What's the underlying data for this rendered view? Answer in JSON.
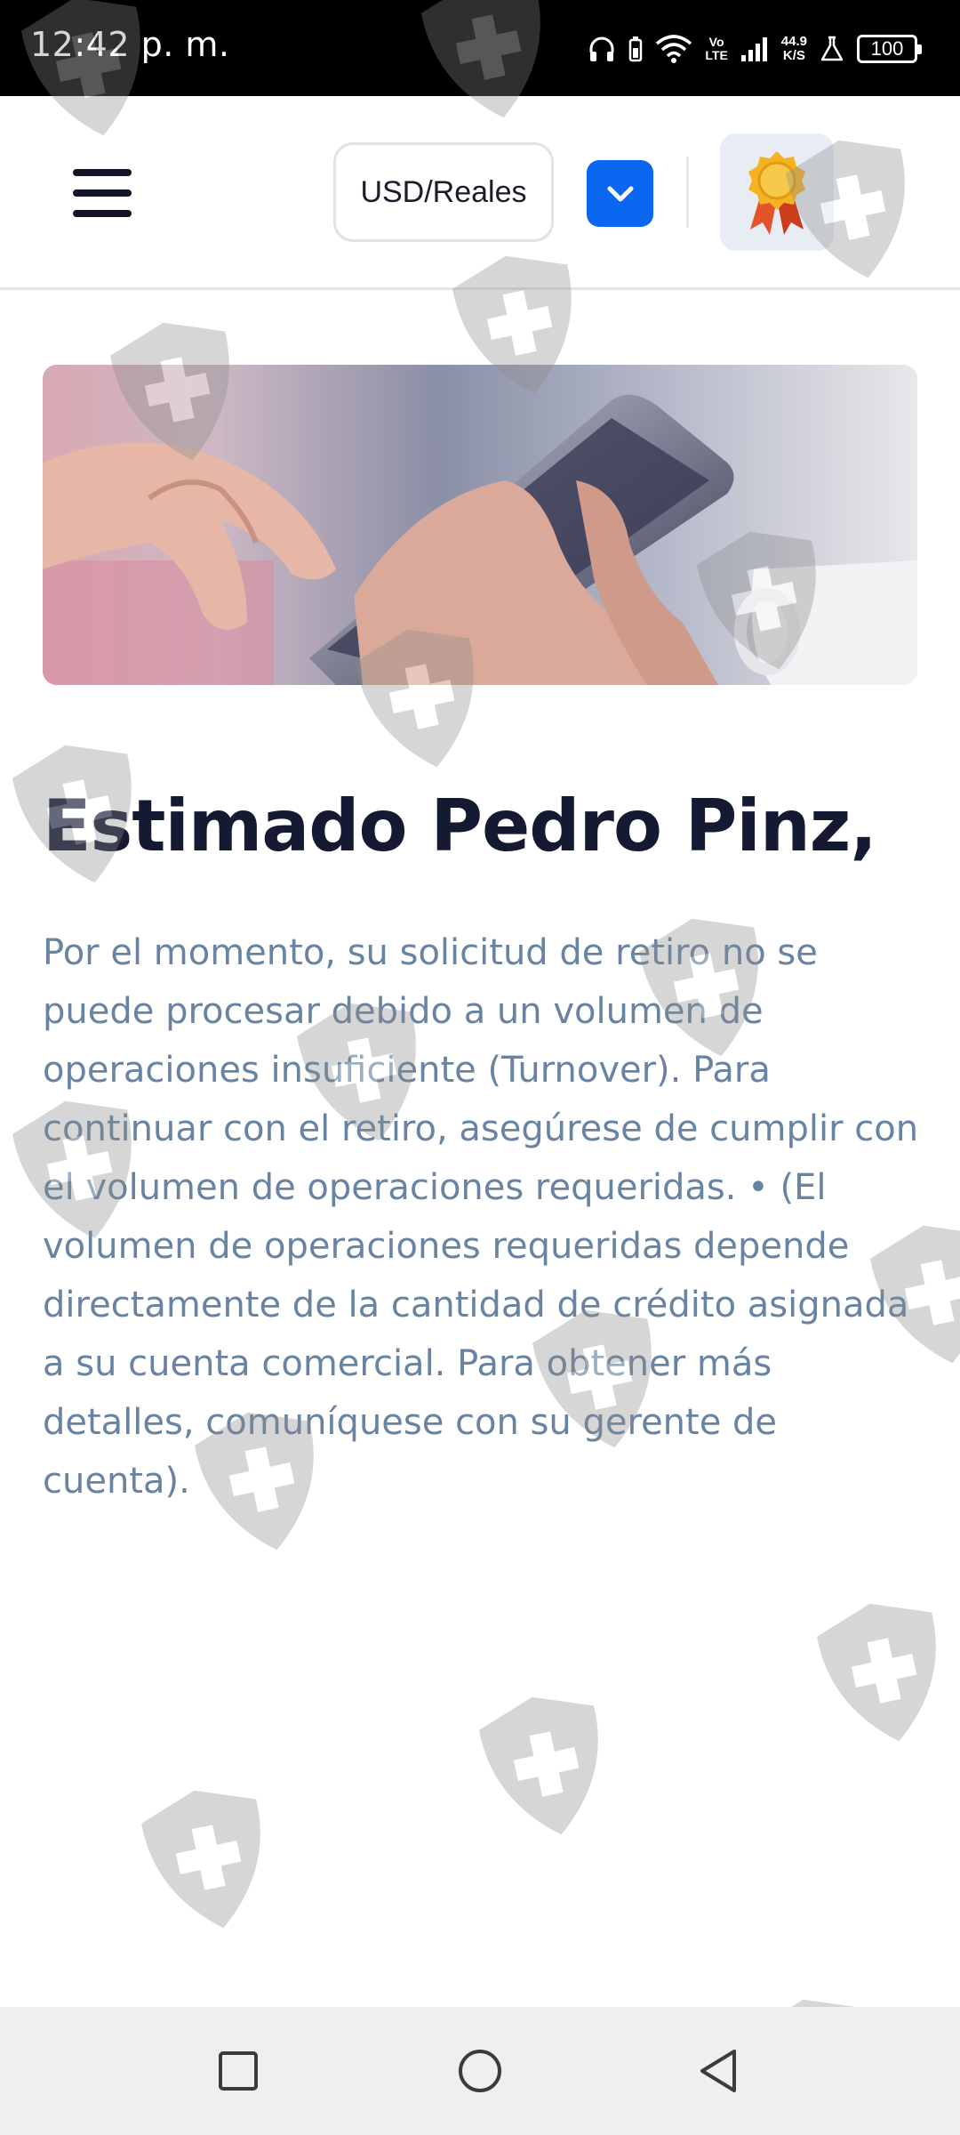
{
  "status_bar": {
    "time": "12:42 p. m.",
    "volte_top": "Vo",
    "volte_bottom": "LTE",
    "net_speed_value": "44.9",
    "net_speed_unit": "K/S",
    "battery": "100",
    "icons": [
      "headphones-icon",
      "battery-saver-icon",
      "wifi-icon",
      "volte-icon",
      "signal-icon",
      "net-speed-icon",
      "flask-icon",
      "battery-icon"
    ]
  },
  "header": {
    "menu_icon": "hamburger-menu-icon",
    "currency_label": "USD/Reales",
    "dropdown_icon": "chevron-down-icon",
    "award_icon": "award-badge-icon",
    "accent_color": "#0b66f0"
  },
  "hero": {
    "image": "hand-holding-smartphone-photo"
  },
  "content": {
    "greeting": "Estimado Pedro Pinz,",
    "message": "Por el momento, su solicitud de retiro no se puede procesar debido a un volumen de operaciones insuficiente (Turnover). Para continuar con el retiro, asegúrese de cumplir con el volumen de operaciones requeridas. • (El volumen de operaciones requeridas depende directamente de la cantidad de crédito asignada a su cuenta comercial. Para obtener más detalles, comuníquese con su gerente de cuenta).",
    "heading_color": "#151a33",
    "text_color": "#6984a2"
  },
  "nav_bar": {
    "icons": [
      "recents-square-icon",
      "home-circle-icon",
      "back-triangle-icon"
    ]
  }
}
